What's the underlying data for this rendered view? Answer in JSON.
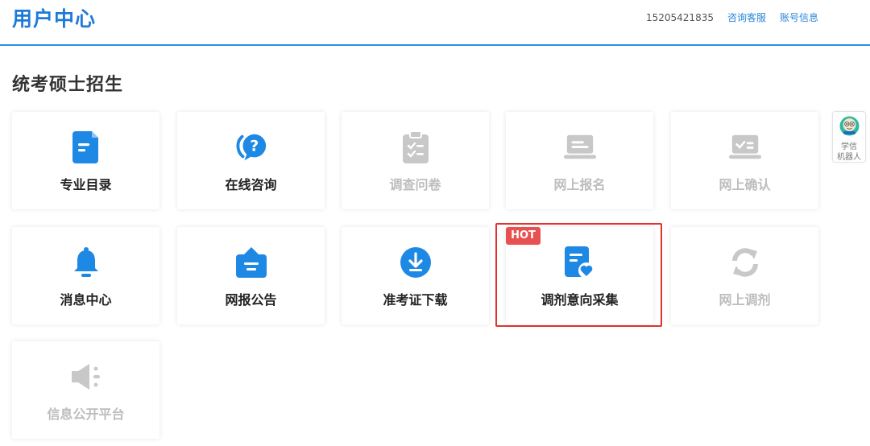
{
  "header": {
    "title": "用户中心",
    "phone": "15205421835",
    "links": [
      "咨询客服",
      "账号信息"
    ]
  },
  "section": {
    "title": "统考硕士招生"
  },
  "tiles": [
    {
      "label": "专业目录",
      "icon": "document-list-icon",
      "enabled": true
    },
    {
      "label": "在线咨询",
      "icon": "question-chat-icon",
      "enabled": true
    },
    {
      "label": "调查问卷",
      "icon": "clipboard-check-icon",
      "enabled": false
    },
    {
      "label": "网上报名",
      "icon": "laptop-icon",
      "enabled": false
    },
    {
      "label": "网上确认",
      "icon": "laptop-check-icon",
      "enabled": false
    },
    {
      "label": "消息中心",
      "icon": "bell-icon",
      "enabled": true
    },
    {
      "label": "网报公告",
      "icon": "announcement-board-icon",
      "enabled": true
    },
    {
      "label": "准考证下载",
      "icon": "download-circle-icon",
      "enabled": true
    },
    {
      "label": "调剂意向采集",
      "icon": "document-heart-icon",
      "enabled": true
    },
    {
      "label": "网上调剂",
      "icon": "refresh-arrows-icon",
      "enabled": false
    },
    {
      "label": "信息公开平台",
      "icon": "speaker-icon",
      "enabled": false
    }
  ],
  "hot_badge": "HOT",
  "robot": {
    "line1": "学信",
    "line2": "机器人"
  },
  "colors": {
    "primary": "#1e88e5",
    "disabled_icon": "#c8c8c8",
    "disabled_text": "#bdbdbd",
    "highlight_border": "#e0322f",
    "hot_badge": "#e7514f"
  }
}
